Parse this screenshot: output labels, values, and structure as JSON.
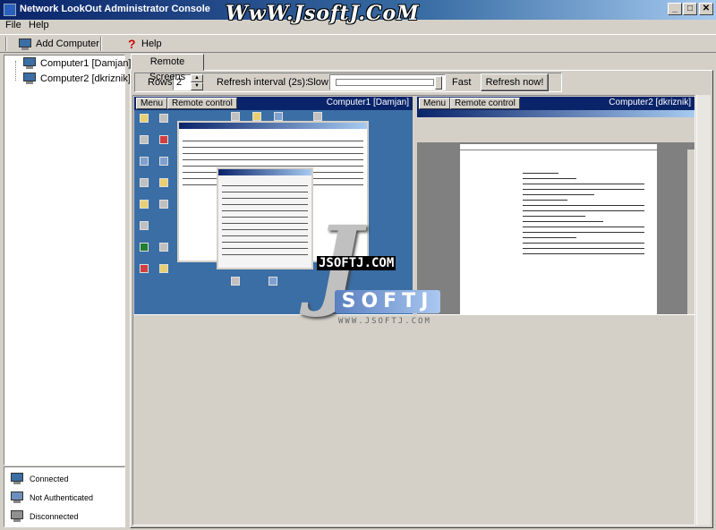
{
  "window": {
    "title": "Network LookOut Administrator Console",
    "watermark": "WwW.JsoftJ.CoM",
    "minimize": "_",
    "maximize": "□",
    "close": "✕"
  },
  "menu": {
    "file": "File",
    "help": "Help"
  },
  "toolbar": {
    "add_computer": "Add Computer",
    "help": "Help"
  },
  "tree": {
    "items": [
      {
        "label": "Computer1 [Damjan]"
      },
      {
        "label": "Computer2 [dkriznik]"
      }
    ]
  },
  "legend": {
    "items": [
      {
        "label": "Connected"
      },
      {
        "label": "Not Authenticated"
      },
      {
        "label": "Disconnected"
      }
    ]
  },
  "tabs": {
    "remote_screens": "Remote Screens"
  },
  "controls": {
    "rows_label": "Rows:",
    "rows_value": "2",
    "refresh_interval_label": "Refresh interval (2s):",
    "slow_label": "Slow",
    "fast_label": "Fast",
    "refresh_now": "Refresh now!"
  },
  "viewers": [
    {
      "menu": "Menu",
      "remote_control": "Remote control",
      "name": "Computer1 [Damjan]"
    },
    {
      "menu": "Menu",
      "remote_control": "Remote control",
      "name": "Computer2 [dkriznik]"
    }
  ],
  "overlay_watermark": {
    "site": "JSOFTJ.COM",
    "band": "SOFTJ",
    "url": "WWW.JSOFTJ.COM"
  },
  "colors": {
    "title_bar": "#0a246a",
    "desktop": "#3a6ea5",
    "face": "#d4d0c8"
  }
}
